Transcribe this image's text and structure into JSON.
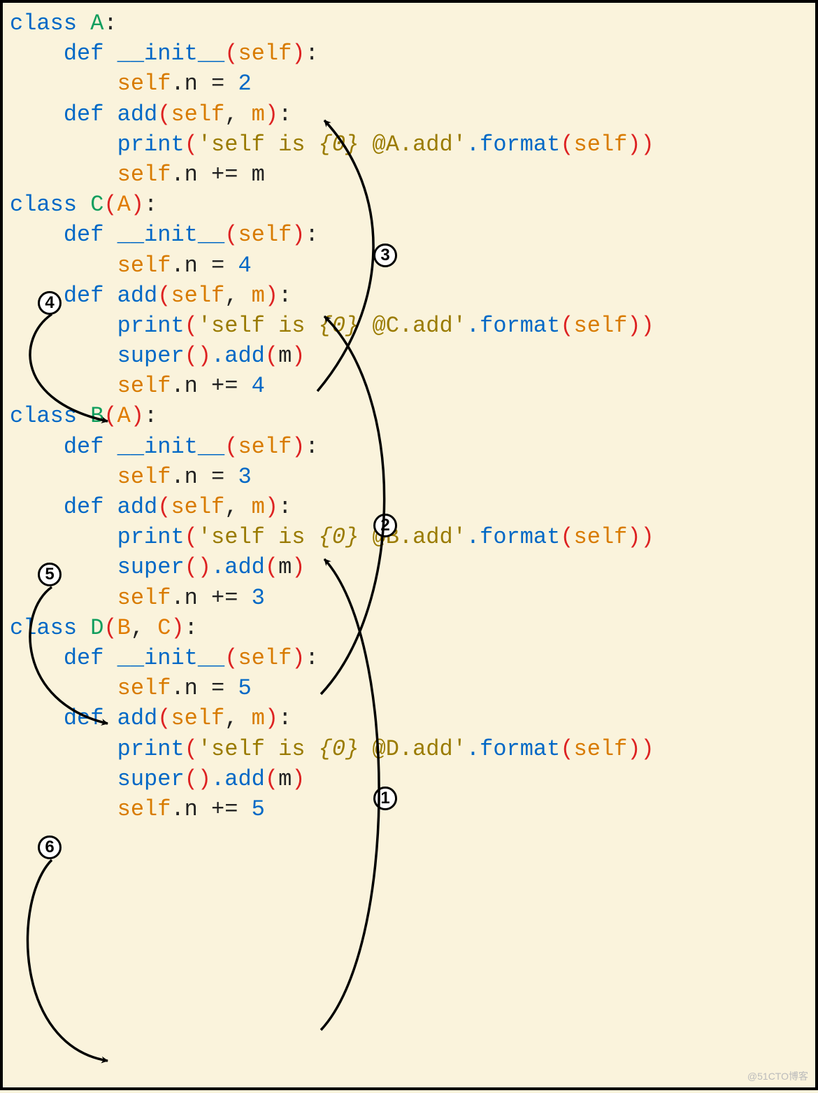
{
  "code": {
    "classA": {
      "decl": "class",
      "name": "A",
      "init": {
        "def": "def",
        "name": "__init__",
        "params": "self",
        "body": "self.n = 2",
        "n_val": "2"
      },
      "add": {
        "def": "def",
        "name": "add",
        "params": "self, m",
        "print_prefix": "print",
        "str1": "'self is ",
        "fmt": "{0}",
        "str2": " @A.add'",
        "fmt_call": ".format",
        "arg": "self",
        "body2": "self.n += m"
      }
    },
    "classC": {
      "decl": "class",
      "name": "C",
      "base": "A",
      "init": {
        "def": "def",
        "name": "__init__",
        "params": "self",
        "body": "self.n = 4",
        "n_val": "4"
      },
      "add": {
        "def": "def",
        "name": "add",
        "params": "self, m",
        "print_prefix": "print",
        "str1": "'self is ",
        "fmt": "{0}",
        "str2": " @C.add'",
        "fmt_call": ".format",
        "arg": "self",
        "super": "super",
        "add_call": ".add",
        "m": "m",
        "body3": "self.n += 4",
        "inc_val": "4"
      }
    },
    "classB": {
      "decl": "class",
      "name": "B",
      "base": "A",
      "init": {
        "def": "def",
        "name": "__init__",
        "params": "self",
        "body": "self.n = 3",
        "n_val": "3"
      },
      "add": {
        "def": "def",
        "name": "add",
        "params": "self, m",
        "print_prefix": "print",
        "str1": "'self is ",
        "fmt": "{0}",
        "str2": " @B.add'",
        "fmt_call": ".format",
        "arg": "self",
        "super": "super",
        "add_call": ".add",
        "m": "m",
        "body3": "self.n += 3",
        "inc_val": "3"
      }
    },
    "classD": {
      "decl": "class",
      "name": "D",
      "base1": "B",
      "base2": "C",
      "init": {
        "def": "def",
        "name": "__init__",
        "params": "self",
        "body": "self.n = 5",
        "n_val": "5"
      },
      "add": {
        "def": "def",
        "name": "add",
        "params": "self, m",
        "print_prefix": "print",
        "str1": "'self is ",
        "fmt": "{0}",
        "str2": " @D.add'",
        "fmt_call": ".format",
        "arg": "self",
        "super": "super",
        "add_call": ".add",
        "m": "m",
        "body3": "self.n += 5",
        "inc_val": "5"
      }
    }
  },
  "annotations": {
    "circled": {
      "1": "1",
      "2": "2",
      "3": "3",
      "4": "4",
      "5": "5",
      "6": "6"
    },
    "arrows_description": "Execution-order arrows: ①D.super().add→B.add, ②B.super().add→C.add, ③C.super().add→A.add, ④C.add end→self.n+=4, ⑤B.add end→self.n+=3, ⑥D.add end→self.n+=5"
  },
  "watermark": "@51CTO博客"
}
